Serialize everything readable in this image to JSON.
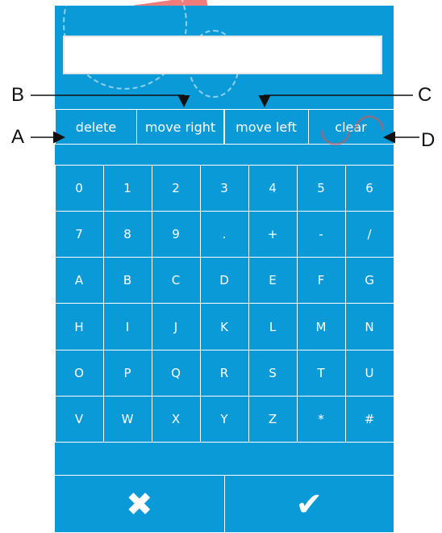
{
  "callouts": {
    "a": "A",
    "b": "B",
    "c": "C",
    "d": "D"
  },
  "functions": {
    "delete": "delete",
    "move_right": "move right",
    "move_left": "move left",
    "clear": "clear"
  },
  "keys": [
    [
      "0",
      "1",
      "2",
      "3",
      "4",
      "5",
      "6"
    ],
    [
      "7",
      "8",
      "9",
      ".",
      "+",
      "-",
      "/"
    ],
    [
      "A",
      "B",
      "C",
      "D",
      "E",
      "F",
      "G"
    ],
    [
      "H",
      "I",
      "J",
      "K",
      "L",
      "M",
      "N"
    ],
    [
      "O",
      "P",
      "Q",
      "R",
      "S",
      "T",
      "U"
    ],
    [
      "V",
      "W",
      "X",
      "Y",
      "Z",
      "*",
      "#"
    ]
  ],
  "actions": {
    "cancel": "✖",
    "confirm": "✔"
  },
  "colors": {
    "panel": "#0b9ad8"
  }
}
